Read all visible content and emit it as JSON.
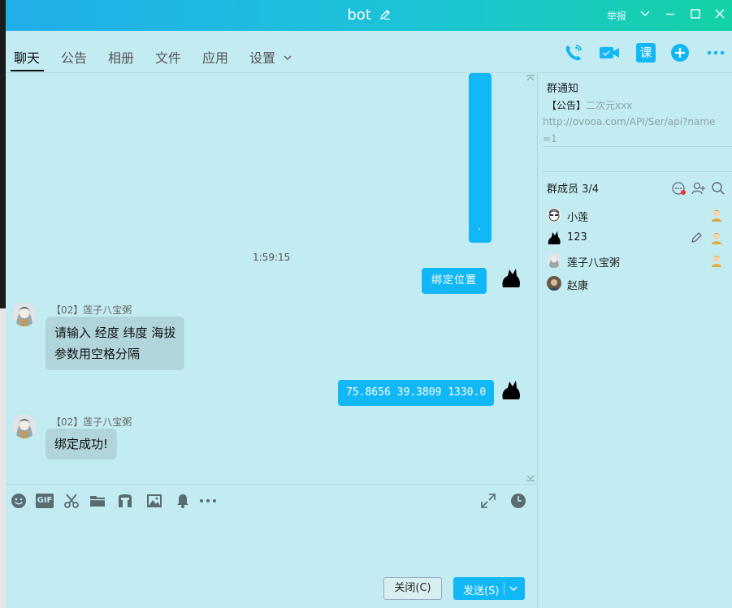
{
  "window": {
    "title": "bot",
    "report_label": "举报"
  },
  "nav": {
    "tabs": [
      {
        "label": "聊天",
        "active": true
      },
      {
        "label": "公告"
      },
      {
        "label": "相册"
      },
      {
        "label": "文件"
      },
      {
        "label": "应用"
      },
      {
        "label": "设置"
      }
    ],
    "actions": [
      "phone-icon",
      "video-icon",
      "class-icon",
      "add-app-icon",
      "more-icon"
    ],
    "class_label": "课"
  },
  "chat": {
    "timestamp": "1:59:15",
    "messages": [
      {
        "from": "me",
        "text": "绑定位置"
      },
      {
        "from": "other",
        "sender": "【02】莲子八宝粥",
        "lines": [
          "请输入 经度 纬度 海拔",
          "参数用空格分隔"
        ]
      },
      {
        "from": "me",
        "text": "75.8656 39.3809 1330.0"
      },
      {
        "from": "other",
        "sender": "【02】莲子八宝粥",
        "lines": [
          "绑定成功!"
        ]
      }
    ],
    "partial_bubble_text": "."
  },
  "toolbar": {
    "icons": [
      "emoji-icon",
      "gif-icon",
      "scissors-icon",
      "folder-icon",
      "music-icon",
      "image-icon",
      "bell-icon",
      "more-dots-icon"
    ],
    "gif_label": "GIF",
    "right_icons": [
      "expand-icon",
      "history-icon"
    ]
  },
  "footer": {
    "close_label": "关闭(C)",
    "send_label": "发送(S)"
  },
  "group_notice": {
    "title": "群通知",
    "prefix": "【公告】",
    "text": "二次元xxx",
    "url": "http://ovooa.com/API/Ser/api?name=1"
  },
  "members": {
    "title": "群成员 3/4",
    "list": [
      {
        "name": "小莲",
        "admin": true
      },
      {
        "name": "123",
        "admin": true,
        "editable": true
      },
      {
        "name": "莲子八宝粥",
        "admin": true
      },
      {
        "name": "赵康",
        "admin": false
      }
    ]
  },
  "colors": {
    "accent": "#12b7f5",
    "background": "#c2ecf2",
    "incoming_bubble": "#b0d5da"
  }
}
